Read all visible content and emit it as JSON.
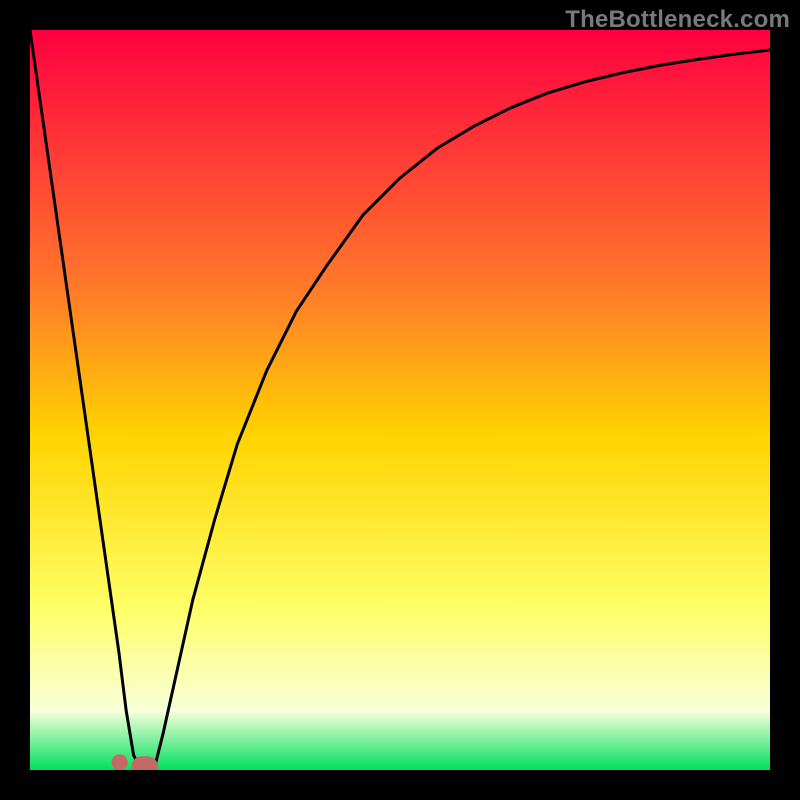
{
  "watermark": "TheBottleneck.com",
  "colors": {
    "frame": "#000000",
    "gradient_top": "#ff0040",
    "gradient_mid_upper": "#ff7a2a",
    "gradient_mid": "#ffd400",
    "gradient_mid_lower": "#ffff66",
    "gradient_low": "#f8ffda",
    "gradient_bottom": "#00e060",
    "curve": "#000000",
    "marker_fill": "#c46a64",
    "marker_edge": "#c46a64"
  },
  "chart_data": {
    "type": "line",
    "title": "",
    "xlabel": "",
    "ylabel": "",
    "xlim": [
      0,
      100
    ],
    "ylim": [
      0,
      100
    ],
    "grid": false,
    "series": [
      {
        "name": "bottleneck-curve",
        "x": [
          0,
          2,
          4,
          6,
          8,
          10,
          12,
          13,
          14,
          15,
          16,
          17,
          18,
          20,
          22,
          25,
          28,
          32,
          36,
          40,
          45,
          50,
          55,
          60,
          65,
          70,
          75,
          80,
          85,
          90,
          95,
          100
        ],
        "y": [
          100,
          86,
          72,
          58,
          44,
          30,
          16,
          8,
          2,
          0,
          0,
          1,
          5,
          14,
          23,
          34,
          44,
          54,
          62,
          68,
          75,
          80,
          84,
          87,
          89.5,
          91.5,
          93,
          94.2,
          95.2,
          96,
          96.7,
          97.3
        ]
      }
    ],
    "markers": [
      {
        "x": 14,
        "y": 1
      },
      {
        "x": 16,
        "y": 0
      },
      {
        "x": 17,
        "y": 1
      }
    ],
    "annotations": []
  }
}
